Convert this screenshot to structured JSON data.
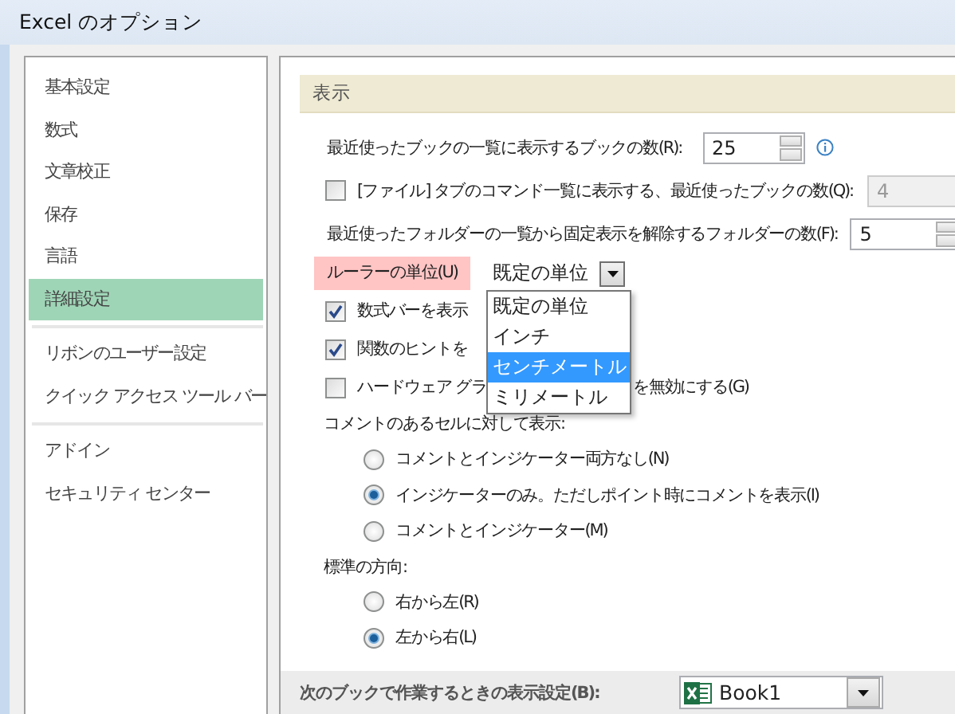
{
  "window": {
    "title": "Excel のオプション"
  },
  "sidebar": {
    "sections": [
      {
        "items": [
          {
            "label": "基本設定",
            "selected": false
          },
          {
            "label": "数式",
            "selected": false
          },
          {
            "label": "文章校正",
            "selected": false
          },
          {
            "label": "保存",
            "selected": false
          },
          {
            "label": "言語",
            "selected": false
          },
          {
            "label": "詳細設定",
            "selected": true
          }
        ]
      },
      {
        "items": [
          {
            "label": "リボンのユーザー設定",
            "selected": false
          },
          {
            "label": "クイック アクセス ツール バー",
            "selected": false
          }
        ]
      },
      {
        "items": [
          {
            "label": "アドイン",
            "selected": false
          },
          {
            "label": "セキュリティ センター",
            "selected": false
          }
        ]
      }
    ]
  },
  "section": {
    "title": "表示"
  },
  "options": [
    {
      "kind": "number",
      "label": "最近使ったブックの一覧に表示するブックの数(R):",
      "value": "25",
      "info": true
    },
    {
      "kind": "checkbox-number",
      "checked": false,
      "label": "[ファイル] タブのコマンド一覧に表示する、最近使ったブックの数(Q):",
      "value": "4",
      "disabled": true
    },
    {
      "kind": "number",
      "label": "最近使ったフォルダーの一覧から固定表示を解除するフォルダーの数(F):",
      "value": "5"
    },
    {
      "kind": "dropdown",
      "label": "ルーラーの単位(U)",
      "highlighted": true,
      "value": "既定の単位",
      "options": [
        {
          "label": "既定の単位",
          "highlighted": false
        },
        {
          "label": "インチ",
          "highlighted": false
        },
        {
          "label": "センチメートル",
          "highlighted": true
        },
        {
          "label": "ミリメートル",
          "highlighted": false
        }
      ]
    },
    {
      "kind": "checkbox",
      "checked": true,
      "label": "数式バーを表示"
    },
    {
      "kind": "checkbox",
      "checked": true,
      "label": "関数のヒントを"
    },
    {
      "kind": "checkbox",
      "checked": false,
      "label": "ハードウェア グラ",
      "label_after": "を無効にする(G)"
    },
    {
      "kind": "heading",
      "label": "コメントのあるセルに対して表示:"
    },
    {
      "kind": "radio",
      "selected": false,
      "label": "コメントとインジケーター両方なし(N)"
    },
    {
      "kind": "radio",
      "selected": true,
      "label": "インジケーターのみ。ただしポイント時にコメントを表示(I)"
    },
    {
      "kind": "radio",
      "selected": false,
      "label": "コメントとインジケーター(M)"
    },
    {
      "kind": "heading",
      "label": "標準の方向:"
    },
    {
      "kind": "radio",
      "selected": false,
      "label": "右から左(R)"
    },
    {
      "kind": "radio",
      "selected": true,
      "label": "左から右(L)"
    }
  ],
  "footer": {
    "title": "次のブックで作業するときの表示設定(B):",
    "workbook": "Book1"
  }
}
